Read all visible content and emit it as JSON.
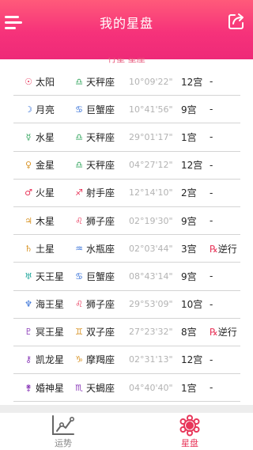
{
  "header": {
    "title": "我的星盘"
  },
  "table_header_partial": "行星 星座",
  "rows": [
    {
      "planet": "太阳",
      "planet_glyph": "☉",
      "sign": "天秤座",
      "sign_glyph": "♎",
      "degree": "10°09'22\"",
      "house": "12宫",
      "retro": "-"
    },
    {
      "planet": "月亮",
      "planet_glyph": "☽",
      "sign": "巨蟹座",
      "sign_glyph": "♋",
      "degree": "10°41'56\"",
      "house": "9宫",
      "retro": "-"
    },
    {
      "planet": "水星",
      "planet_glyph": "☿",
      "sign": "天秤座",
      "sign_glyph": "♎",
      "degree": "29°01'17\"",
      "house": "1宫",
      "retro": "-"
    },
    {
      "planet": "金星",
      "planet_glyph": "♀",
      "sign": "天秤座",
      "sign_glyph": "♎",
      "degree": "04°27'12\"",
      "house": "12宫",
      "retro": "-"
    },
    {
      "planet": "火星",
      "planet_glyph": "♂",
      "sign": "射手座",
      "sign_glyph": "♐",
      "degree": "12°14'10\"",
      "house": "2宫",
      "retro": "-"
    },
    {
      "planet": "木星",
      "planet_glyph": "♃",
      "sign": "狮子座",
      "sign_glyph": "♌",
      "degree": "02°19'30\"",
      "house": "9宫",
      "retro": "-"
    },
    {
      "planet": "土星",
      "planet_glyph": "♄",
      "sign": "水瓶座",
      "sign_glyph": "♒",
      "degree": "02°03'44\"",
      "house": "3宫",
      "retro": "℞逆行"
    },
    {
      "planet": "天王星",
      "planet_glyph": "♅",
      "sign": "巨蟹座",
      "sign_glyph": "♋",
      "degree": "08°43'14\"",
      "house": "9宫",
      "retro": "-"
    },
    {
      "planet": "海王星",
      "planet_glyph": "♆",
      "sign": "狮子座",
      "sign_glyph": "♌",
      "degree": "29°53'09\"",
      "house": "10宫",
      "retro": "-"
    },
    {
      "planet": "冥王星",
      "planet_glyph": "♇",
      "sign": "双子座",
      "sign_glyph": "♊",
      "degree": "27°23'32\"",
      "house": "8宫",
      "retro": "℞逆行"
    },
    {
      "planet": "凯龙星",
      "planet_glyph": "⚷",
      "sign": "摩羯座",
      "sign_glyph": "♑",
      "degree": "02°31'13\"",
      "house": "12宫",
      "retro": "-"
    },
    {
      "planet": "婚神星",
      "planet_glyph": "⚵",
      "sign": "天蝎座",
      "sign_glyph": "♏",
      "degree": "04°40'40\"",
      "house": "1宫",
      "retro": "-"
    }
  ],
  "tabs": [
    {
      "label": "运势",
      "icon": "trend-chart-icon"
    },
    {
      "label": "星盘",
      "icon": "astro-chart-icon"
    }
  ],
  "colors": {
    "accent": "#ee2a78",
    "active_tab": "#e8365a",
    "degree_text": "#b3b3b3"
  }
}
